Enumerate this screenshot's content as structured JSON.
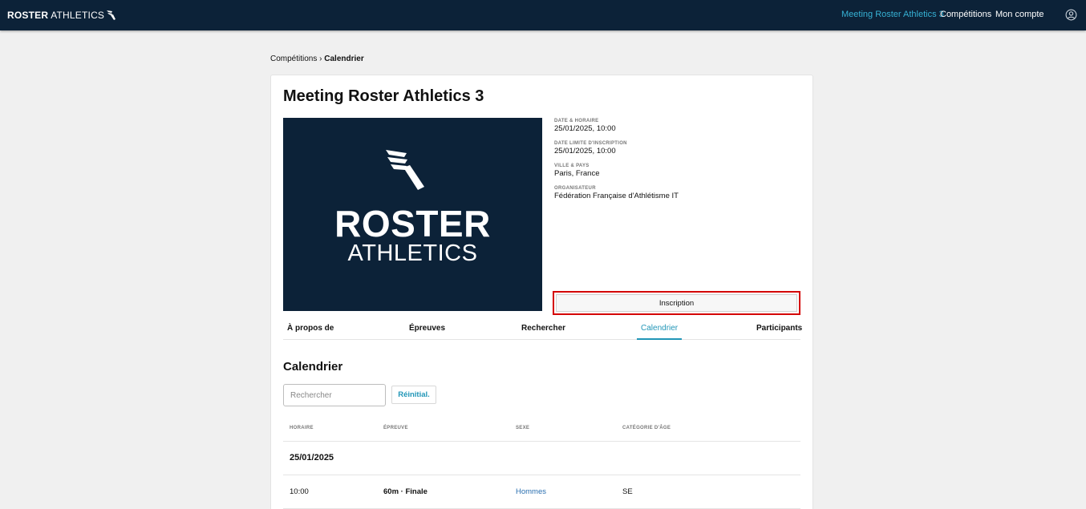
{
  "nav": {
    "brand_bold": "ROSTER",
    "brand_light": "ATHLETICS",
    "links": [
      "Meeting Roster Athletics 3",
      "Compétitions",
      "Mon compte"
    ],
    "active_color": "#36b1d4"
  },
  "breadcrumb": {
    "parent": "Compétitions",
    "separator": "›",
    "current": "Calendrier"
  },
  "event": {
    "title": "Meeting Roster Athletics 3",
    "hero_line1": "ROSTER",
    "hero_line2": "ATHLETICS",
    "info": [
      {
        "label": "DATE & HORAIRE",
        "value": "25/01/2025, 10:00"
      },
      {
        "label": "DATE LIMITE D'INSCRIPTION",
        "value": "25/01/2025, 10:00"
      },
      {
        "label": "VILLE & PAYS",
        "value": "Paris, France"
      },
      {
        "label": "ORGANISATEUR",
        "value": "Fédération Française d'Athlétisme IT"
      }
    ],
    "signup_label": "Inscription"
  },
  "tabs": [
    "À propos de",
    "Épreuves",
    "Rechercher",
    "Calendrier",
    "Participants"
  ],
  "active_tab": "Calendrier",
  "schedule": {
    "title": "Calendrier",
    "search_placeholder": "Rechercher",
    "reset_label": "Réinitial.",
    "headers": [
      "HORAIRE",
      "ÉPREUVE",
      "SEXE",
      "CATÉGORIE D'ÂGE"
    ],
    "groups": [
      {
        "date": "25/01/2025",
        "rows": [
          {
            "time": "10:00",
            "event": "60m · Finale",
            "sex": "Hommes",
            "category": "SE"
          }
        ]
      }
    ]
  },
  "colors": {
    "navy": "#0c2238",
    "accent": "#2196b7",
    "highlight": "#d40000",
    "link": "#2a6fb0"
  }
}
